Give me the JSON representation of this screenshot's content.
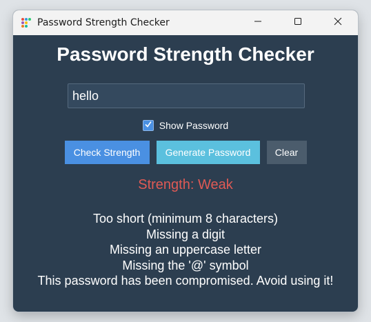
{
  "window": {
    "title": "Password Strength Checker",
    "icon": "app-dots-icon",
    "controls": [
      "minimize-icon",
      "maximize-icon",
      "close-icon"
    ]
  },
  "app": {
    "heading": "Password Strength Checker",
    "password_value": "hello",
    "show_password": {
      "checked": true,
      "label": "Show Password"
    },
    "buttons": {
      "check": "Check Strength",
      "generate": "Generate Password",
      "clear": "Clear"
    },
    "strength_text": "Strength: Weak",
    "messages": [
      "Too short (minimum 8 characters)",
      "Missing a digit",
      "Missing an uppercase letter",
      "Missing the '@' symbol",
      "This password has been compromised. Avoid using it!"
    ]
  },
  "colors": {
    "background": "#2c3e50",
    "weak": "#e05a55",
    "check_button": "#4a90e2",
    "generate_button": "#5bc0de",
    "clear_button": "#4b5c6c"
  }
}
